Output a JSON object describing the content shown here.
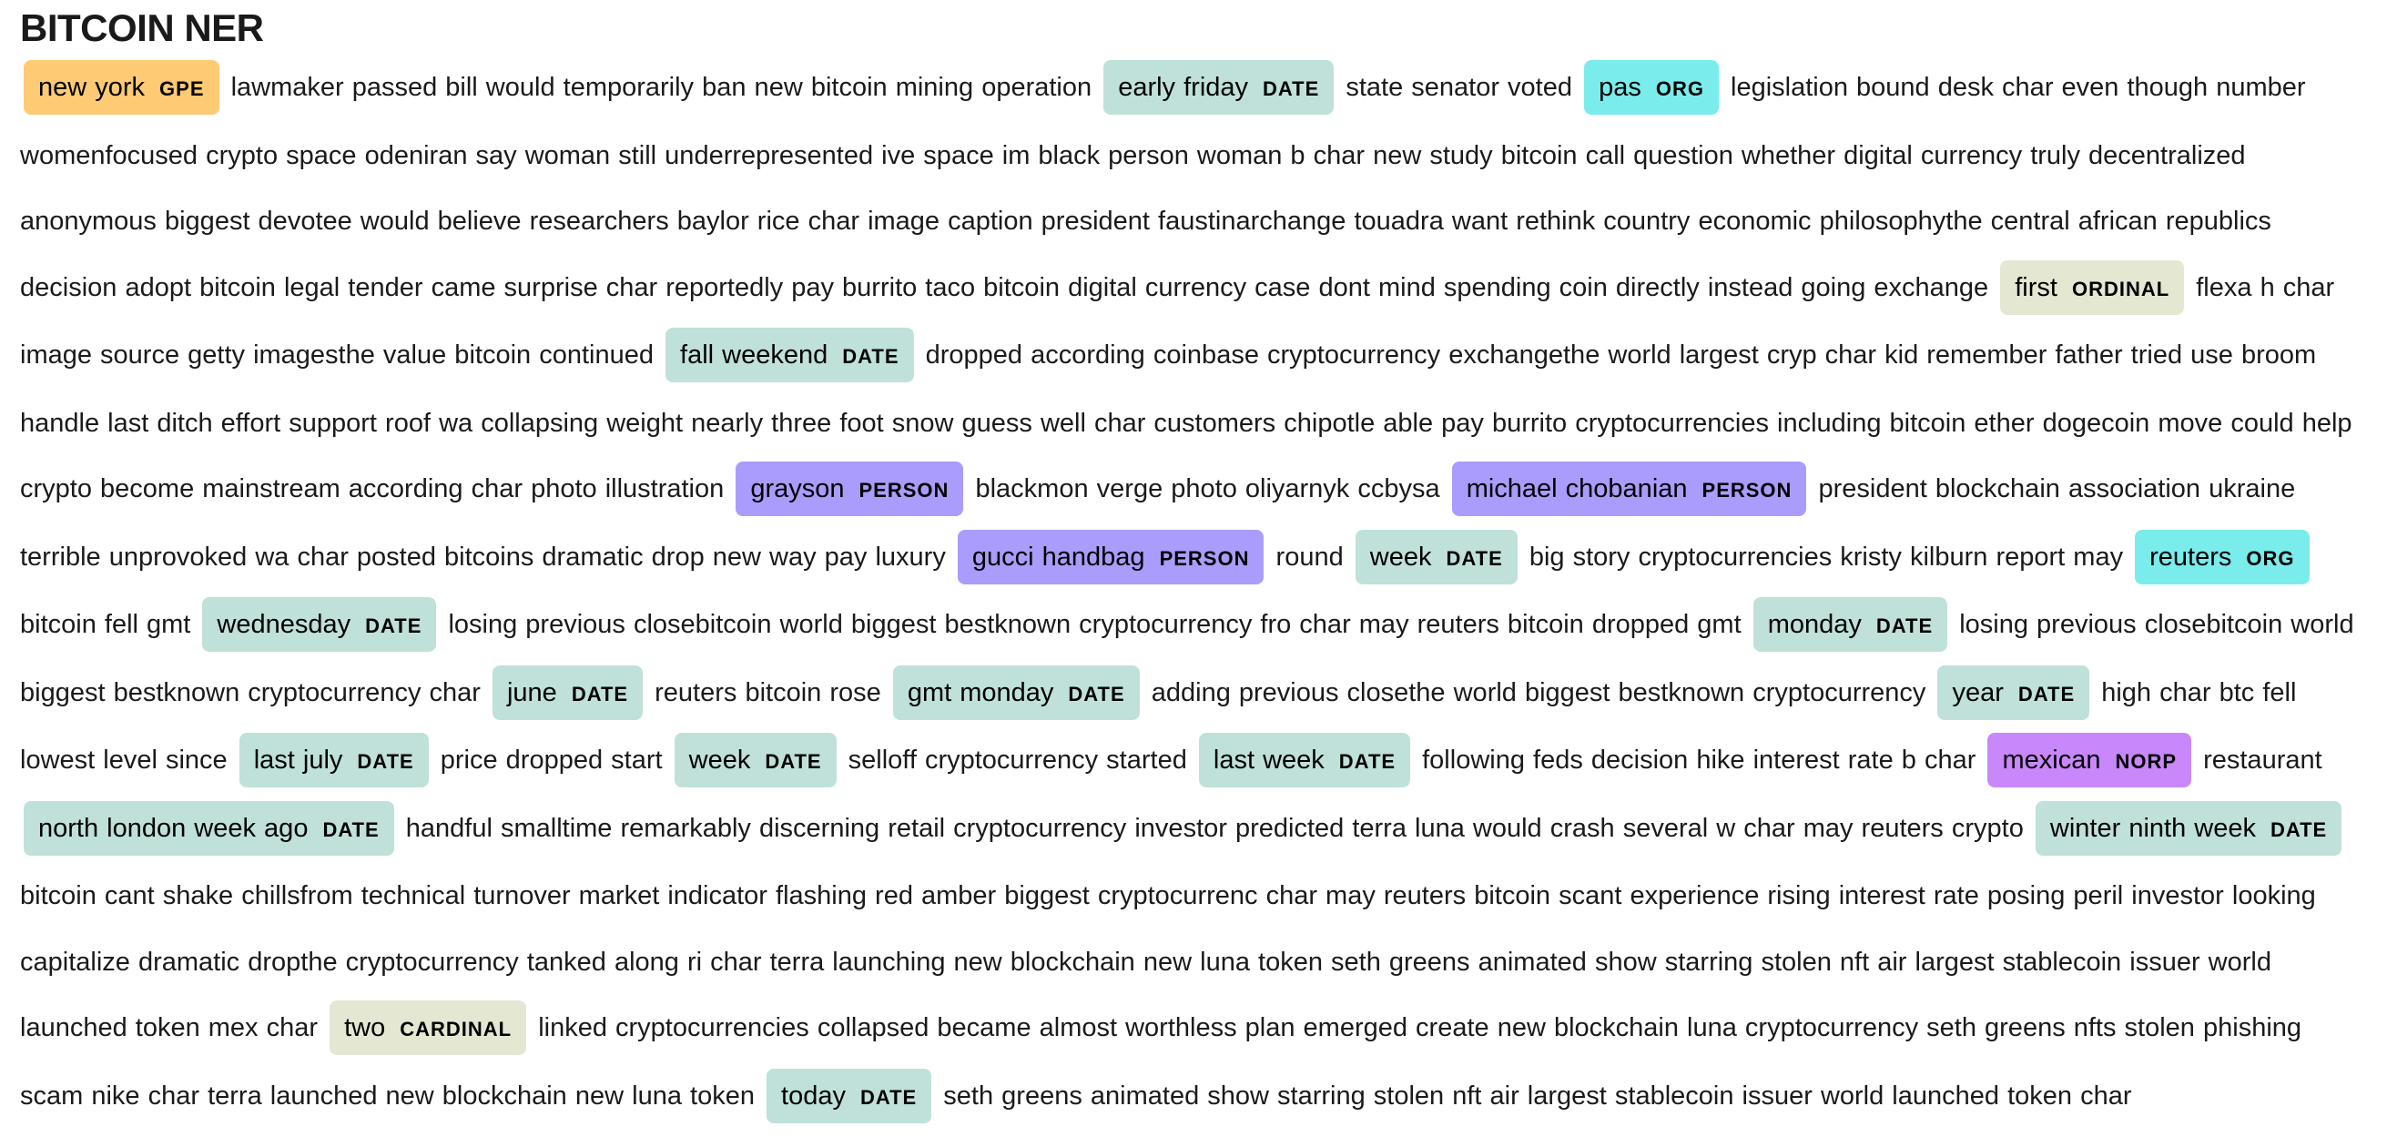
{
  "title": "BITCOIN NER",
  "colors": {
    "GPE": "#feca74",
    "DATE": "#bfe1d9",
    "ORG": "#7aecec",
    "PERSON": "#aa9cfc",
    "ORDINAL": "#e4e7d2",
    "NORP": "#c887fb",
    "CARDINAL": "#e4e7d2"
  },
  "segments": [
    {
      "text": "new york",
      "label": "GPE"
    },
    {
      "text": "lawmaker passed bill would temporarily ban new bitcoin mining operation"
    },
    {
      "text": "early friday",
      "label": "DATE"
    },
    {
      "text": "state senator voted"
    },
    {
      "text": "pas",
      "label": "ORG"
    },
    {
      "text": "legislation bound desk char even though number womenfocused crypto space odeniran say woman still underrepresented ive space im black person woman b char new study bitcoin call question whether digital currency truly decentralized anonymous biggest devotee would believe researchers baylor rice char image caption president faustinarchange touadra want rethink country economic philosophythe central african republics decision adopt bitcoin legal tender came surprise char reportedly pay burrito taco bitcoin digital currency case dont mind spending coin directly instead going exchange"
    },
    {
      "text": "first",
      "label": "ORDINAL"
    },
    {
      "text": "flexa h char image source getty imagesthe value bitcoin continued"
    },
    {
      "text": "fall weekend",
      "label": "DATE"
    },
    {
      "text": "dropped according coinbase cryptocurrency exchangethe world largest cryp char kid remember father tried use broom handle last ditch effort support roof wa collapsing weight nearly three foot snow guess well char customers chipotle able pay burrito cryptocurrencies including bitcoin ether dogecoin move could help crypto become mainstream according char photo illustration"
    },
    {
      "text": "grayson",
      "label": "PERSON"
    },
    {
      "text": "blackmon verge photo oliyarnyk ccbysa"
    },
    {
      "text": "michael chobanian",
      "label": "PERSON"
    },
    {
      "text": "president blockchain association ukraine terrible unprovoked wa char posted bitcoins dramatic drop new way pay luxury"
    },
    {
      "text": "gucci handbag",
      "label": "PERSON"
    },
    {
      "text": "round"
    },
    {
      "text": "week",
      "label": "DATE"
    },
    {
      "text": "big story cryptocurrencies kristy kilburn report may"
    },
    {
      "text": "reuters",
      "label": "ORG"
    },
    {
      "text": "bitcoin fell gmt"
    },
    {
      "text": "wednesday",
      "label": "DATE"
    },
    {
      "text": "losing previous closebitcoin world biggest bestknown cryptocurrency fro char may reuters bitcoin dropped gmt"
    },
    {
      "text": "monday",
      "label": "DATE"
    },
    {
      "text": "losing previous closebitcoin world biggest bestknown cryptocurrency char"
    },
    {
      "text": "june",
      "label": "DATE"
    },
    {
      "text": "reuters bitcoin rose"
    },
    {
      "text": "gmt monday",
      "label": "DATE"
    },
    {
      "text": "adding previous closethe world biggest bestknown cryptocurrency"
    },
    {
      "text": "year",
      "label": "DATE"
    },
    {
      "text": "high char btc fell lowest level since"
    },
    {
      "text": "last july",
      "label": "DATE"
    },
    {
      "text": "price dropped start"
    },
    {
      "text": "week",
      "label": "DATE"
    },
    {
      "text": "selloff cryptocurrency started"
    },
    {
      "text": "last week",
      "label": "DATE"
    },
    {
      "text": "following feds decision hike interest rate b char"
    },
    {
      "text": "mexican",
      "label": "NORP"
    },
    {
      "text": "restaurant"
    },
    {
      "text": "north london week ago",
      "label": "DATE"
    },
    {
      "text": "handful smalltime remarkably discerning retail cryptocurrency investor predicted terra luna would crash several w char may reuters crypto"
    },
    {
      "text": "winter ninth week",
      "label": "DATE"
    },
    {
      "text": "bitcoin cant shake chillsfrom technical turnover market indicator flashing red amber biggest cryptocurrenc char may reuters bitcoin scant experience rising interest rate posing peril investor looking capitalize dramatic dropthe cryptocurrency tanked along ri char terra launching new blockchain new luna token seth greens animated show starring stolen nft air largest stablecoin issuer world launched token mex char"
    },
    {
      "text": "two",
      "label": "CARDINAL"
    },
    {
      "text": "linked cryptocurrencies collapsed became almost worthless plan emerged create new blockchain luna cryptocurrency seth greens nfts stolen phishing scam nike char terra launched new blockchain new luna token"
    },
    {
      "text": "today",
      "label": "DATE"
    },
    {
      "text": "seth greens animated show starring stolen nft air largest stablecoin issuer world launched token char"
    }
  ]
}
